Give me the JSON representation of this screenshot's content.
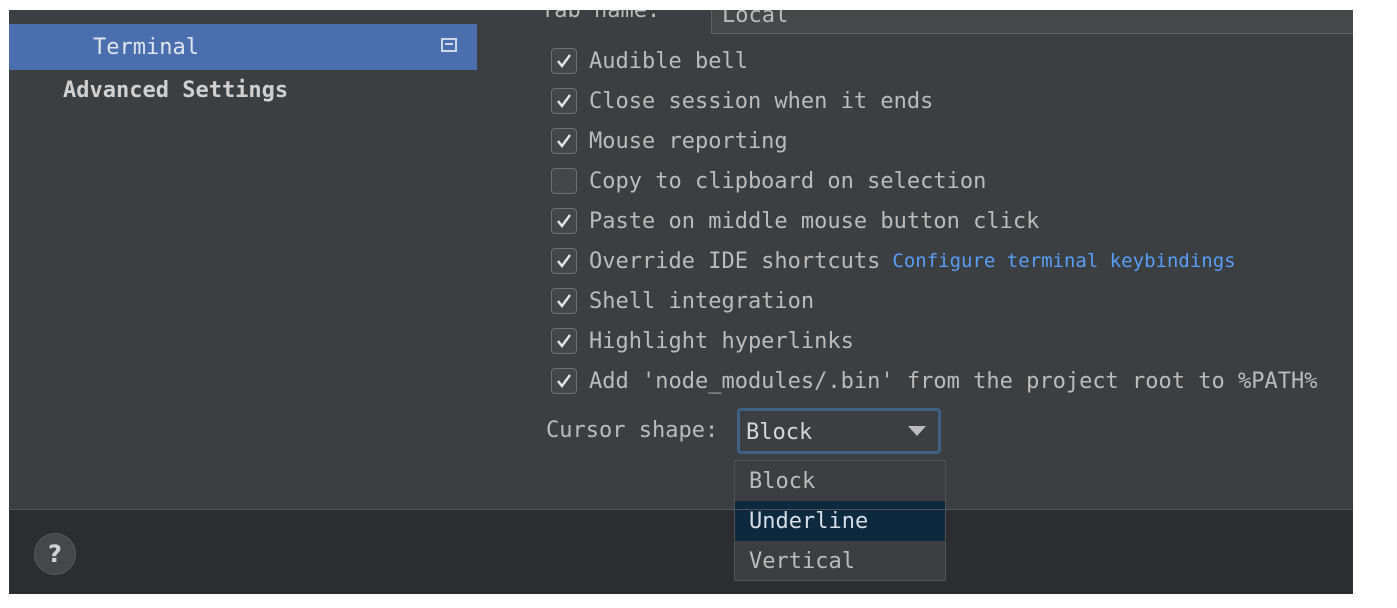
{
  "sidebar": {
    "items": [
      {
        "label": "Terminal",
        "selected": true
      },
      {
        "label": "Advanced Settings",
        "selected": false
      }
    ]
  },
  "settings": {
    "tab_name": {
      "label": "Tab name:",
      "value": "Local"
    },
    "checkboxes": [
      {
        "label": "Audible bell",
        "checked": true
      },
      {
        "label": "Close session when it ends",
        "checked": true
      },
      {
        "label": "Mouse reporting",
        "checked": true
      },
      {
        "label": "Copy to clipboard on selection",
        "checked": false
      },
      {
        "label": "Paste on middle mouse button click",
        "checked": true
      },
      {
        "label": "Override IDE shortcuts",
        "checked": true,
        "link": "Configure terminal keybindings"
      },
      {
        "label": "Shell integration",
        "checked": true
      },
      {
        "label": "Highlight hyperlinks",
        "checked": true
      },
      {
        "label": "Add 'node_modules/.bin' from the project root to %PATH%",
        "checked": true
      }
    ],
    "cursor_shape": {
      "label": "Cursor shape:",
      "value": "Block",
      "options": [
        "Block",
        "Underline",
        "Vertical"
      ],
      "highlighted_option": "Underline"
    }
  },
  "footer": {
    "help_label": "?"
  },
  "colors": {
    "sidebar_selected": "#4b6eaf",
    "panel_bg": "#3c3f41",
    "link": "#589df6",
    "focus_border": "#3d6185",
    "dropdown_highlight": "#0d293e"
  }
}
